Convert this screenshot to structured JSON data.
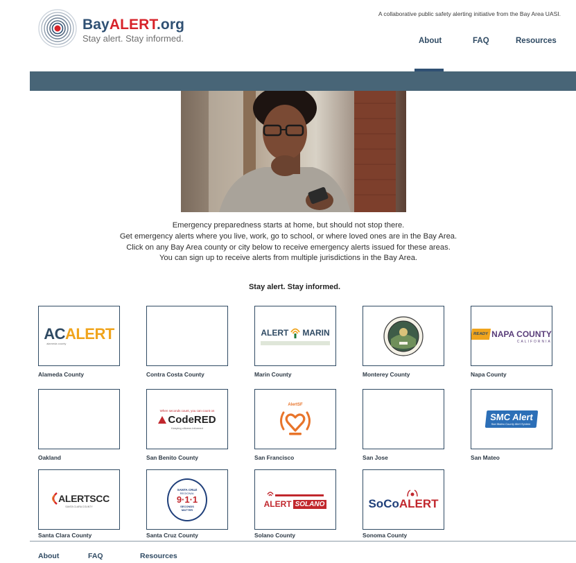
{
  "header": {
    "brand_prefix": "Bay",
    "brand_accent": "ALERT",
    "brand_suffix": ".org",
    "tagline": "Stay alert. Stay informed.",
    "note": "A collaborative public safety alerting initiative from the Bay Area UASI.",
    "nav": [
      {
        "label": "About",
        "active": true
      },
      {
        "label": "FAQ",
        "active": false
      },
      {
        "label": "Resources",
        "active": false
      }
    ]
  },
  "intro": {
    "lines": [
      "Emergency preparedness starts at home, but should not stop there.",
      "Get emergency alerts where you live, work, go to school, or where loved ones are in the Bay Area.",
      "Click on any Bay Area county or city below to receive emergency alerts issued for these areas.",
      "You can sign up to receive alerts from multiple jurisdictions in the Bay Area."
    ],
    "tagline": "Stay alert. Stay informed."
  },
  "jurisdictions": [
    {
      "label": "Alameda County",
      "logo_text": "AC ALERT"
    },
    {
      "label": "Contra Costa County",
      "logo_text": ""
    },
    {
      "label": "Marin County",
      "logo_text": "ALERT MARIN"
    },
    {
      "label": "Monterey County",
      "logo_text": ""
    },
    {
      "label": "Napa County",
      "logo_text": "NAPA COUNTY"
    },
    {
      "label": "Oakland",
      "logo_text": ""
    },
    {
      "label": "San Benito County",
      "logo_text": "CodeRED"
    },
    {
      "label": "San Francisco",
      "logo_text": "AlertSF"
    },
    {
      "label": "San Jose",
      "logo_text": ""
    },
    {
      "label": "San Mateo",
      "logo_text": "SMC Alert"
    },
    {
      "label": "Santa Clara County",
      "logo_text": "ALERTSCC"
    },
    {
      "label": "Santa Cruz County",
      "logo_text": "9-1-1"
    },
    {
      "label": "Solano County",
      "logo_text": "ALERT SOLANO"
    },
    {
      "label": "Sonoma County",
      "logo_text": "SoCoALERT"
    }
  ],
  "logos": {
    "ac_prefix": "AC",
    "ac_suffix": "ALERT",
    "ac_sub": "alameda county",
    "marin_left": "ALERT",
    "marin_right": "MARIN",
    "napa_badge": "READY",
    "napa_name": "NAPA COUNTY",
    "napa_sub": "CALIFORNIA",
    "codered_top": "When seconds count, you can count on",
    "codered_name": "CodeRED",
    "codered_sub": "Keeping citizens informed",
    "alertsf_name": "AlertSF",
    "smc_name": "SMC Alert",
    "smc_sub": "San Mateo County Alert System",
    "scc_name": "ALERTSCC",
    "scc_sub": "SANTA CLARA COUNTY",
    "cruz_top": "SANTA CRUZ",
    "cruz_mid": "REGIONAL",
    "cruz_num": "9·1·1",
    "cruz_bot1": "SECONDS",
    "cruz_bot2": "MATTER",
    "solano_left": "ALERT",
    "solano_right": "SOLANO",
    "soco_prefix": "SoCo",
    "soco_suffix": "ALERT"
  },
  "footer": {
    "links": [
      "About",
      "FAQ",
      "Resources"
    ]
  },
  "colors": {
    "brand_navy": "#2f5073",
    "brand_red": "#d7232a",
    "banner": "#486577",
    "tile_border": "#2f4a63"
  }
}
